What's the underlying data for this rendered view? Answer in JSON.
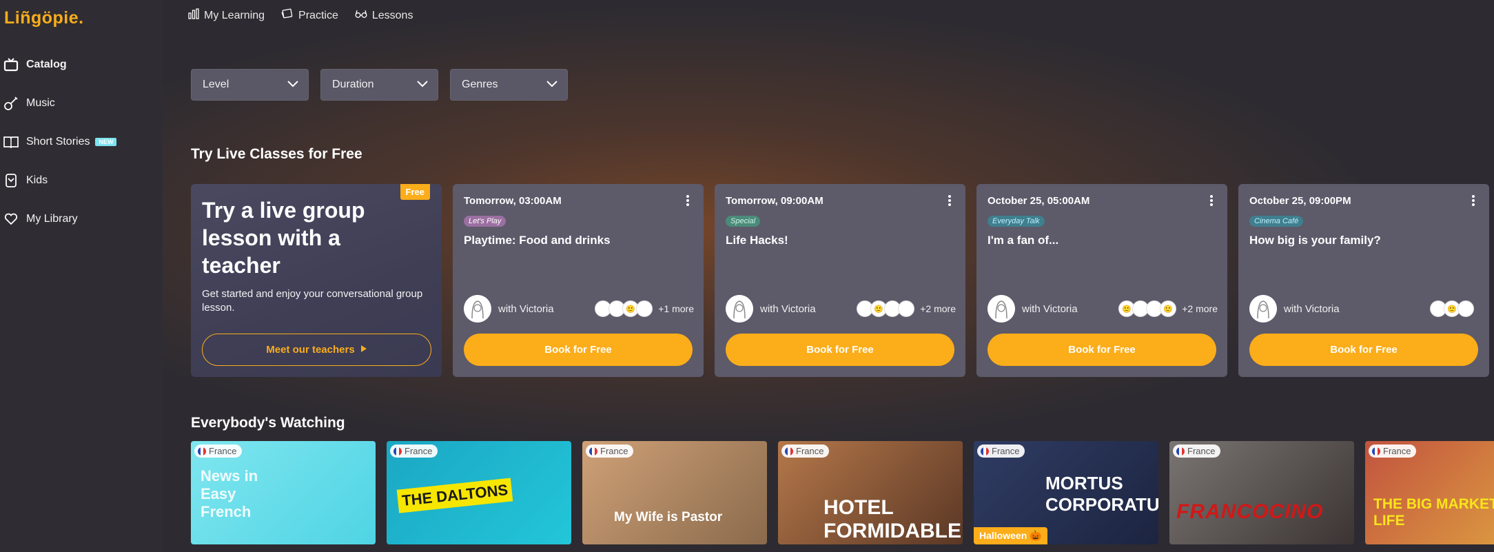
{
  "app": {
    "logo": "Liñgöpie."
  },
  "sidebar": {
    "items": [
      {
        "label": "Catalog",
        "icon": "tv-icon",
        "active": true
      },
      {
        "label": "Music",
        "icon": "guitar-icon",
        "active": false
      },
      {
        "label": "Short Stories",
        "icon": "book-icon",
        "active": false,
        "badge": "NEW"
      },
      {
        "label": "Kids",
        "icon": "kids-icon",
        "active": false
      },
      {
        "label": "My Library",
        "icon": "heart-icon",
        "active": false
      }
    ]
  },
  "topnav": {
    "items": [
      {
        "label": "My Learning",
        "icon": "chart-icon"
      },
      {
        "label": "Practice",
        "icon": "cards-icon"
      },
      {
        "label": "Lessons",
        "icon": "glasses-icon"
      }
    ]
  },
  "filters": [
    {
      "label": "Level"
    },
    {
      "label": "Duration"
    },
    {
      "label": "Genres"
    }
  ],
  "live": {
    "title": "Try Live Classes for Free",
    "promo": {
      "tag": "Free",
      "title": "Try a live group lesson with a teacher",
      "subtitle": "Get started and enjoy your conversational group lesson.",
      "button": "Meet our teachers"
    },
    "lessons": [
      {
        "time": "Tomorrow, 03:00AM",
        "category": "Let's Play",
        "cat_bg": "#9b6fa1",
        "cat_fg": "#fff",
        "title": "Playtime: Food and drinks",
        "teacher": "with Victoria",
        "participants": [
          "😀",
          "😃",
          "🙂",
          "😊"
        ],
        "more": "+1 more",
        "button": "Book for Free"
      },
      {
        "time": "Tomorrow, 09:00AM",
        "category": "Special",
        "cat_bg": "#4b8b7a",
        "cat_fg": "#cdf5e6",
        "title": "Life Hacks!",
        "teacher": "with Victoria",
        "participants": [
          "😀",
          "🙂",
          "😎",
          "😊"
        ],
        "more": "+2 more",
        "button": "Book for Free"
      },
      {
        "time": "October 25, 05:00AM",
        "category": "Everyday Talk",
        "cat_bg": "#3f7f8e",
        "cat_fg": "#bff0ff",
        "title": "I'm a fan of...",
        "teacher": "with Victoria",
        "participants": [
          "🙂",
          "😀",
          "😊",
          "🙂"
        ],
        "more": "+2 more",
        "button": "Book for Free"
      },
      {
        "time": "October 25, 09:00PM",
        "category": "Cinema Café",
        "cat_bg": "#3f7f8e",
        "cat_fg": "#bff0ff",
        "title": "How big is your family?",
        "teacher": "with Victoria",
        "participants": [
          "😀",
          "🙂",
          "😊"
        ],
        "more": "",
        "button": "Book for Free"
      }
    ]
  },
  "watching": {
    "title": "Everybody's Watching",
    "tiles": [
      {
        "country": "France",
        "text": "News in Easy French",
        "bg": "linear-gradient(135deg,#7fe6ef,#4fd4e4)"
      },
      {
        "country": "France",
        "text": "THE DALTONS",
        "bg": "linear-gradient(135deg,#1ba7c4,#23c6d8)"
      },
      {
        "country": "France",
        "text": "My Wife is Pastor",
        "bg": "linear-gradient(135deg,#cfa177,#8a6a4c)"
      },
      {
        "country": "France",
        "text": "HOTEL FORMIDABLE",
        "bg": "linear-gradient(135deg,#b5784a,#5a3725)"
      },
      {
        "country": "France",
        "text": "MORTUS CORPORATUS",
        "bg": "linear-gradient(135deg,#2f3c63,#1c2440)",
        "badge": "Halloween 🎃"
      },
      {
        "country": "France",
        "text": "FRANCOCINO",
        "bg": "linear-gradient(135deg,#7a7573,#3b3433)"
      },
      {
        "country": "France",
        "text": "THE BIG MARKET OF LIFE",
        "bg": "linear-gradient(135deg,#c2533f,#e0a640)"
      }
    ]
  }
}
